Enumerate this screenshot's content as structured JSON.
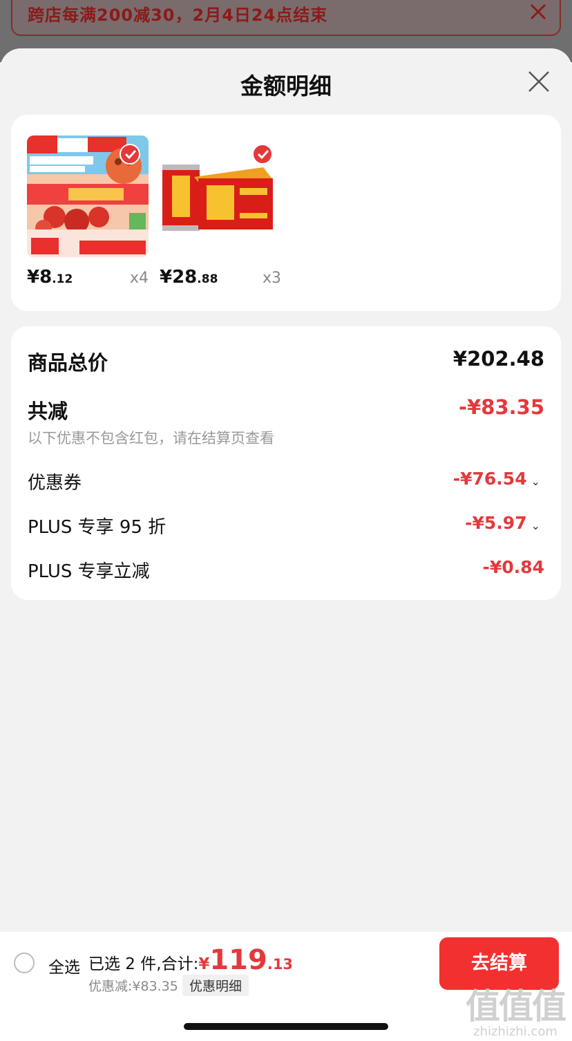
{
  "promo": {
    "text": "跨店每满200减30，2月4日24点结束"
  },
  "sheet": {
    "title": "金额明细"
  },
  "products": [
    {
      "price_int": "¥8",
      "price_dec": ".12",
      "qty": "x4",
      "thumb_icon": "hawthorn-snack-icon"
    },
    {
      "price_int": "¥28",
      "price_dec": ".88",
      "qty": "x3",
      "thumb_icon": "herbal-tea-can-icon"
    }
  ],
  "summary": {
    "total_label": "商品总价",
    "total_value": "¥202.48",
    "reduce_label": "共减",
    "reduce_value": "-¥83.35",
    "note": "以下优惠不包含红包，请在结算页查看",
    "items": [
      {
        "label": "优惠券",
        "value": "-¥76.54",
        "expandable": true
      },
      {
        "label": "PLUS 专享 95 折",
        "value": "-¥5.97",
        "expandable": true
      },
      {
        "label": "PLUS 专享立减",
        "value": "-¥0.84",
        "expandable": false
      }
    ]
  },
  "bottom": {
    "select_all": "全选",
    "selected_prefix": "已选 2 件,合计:",
    "currency": "¥",
    "amount_int": "119",
    "amount_dec": ".13",
    "discount": "优惠减:¥83.35",
    "detail_chip": "优惠明细",
    "checkout": "去结算"
  },
  "watermark": {
    "big": "值值值",
    "small": "zhizhizhi.com"
  },
  "colors": {
    "accent": "#e4393c",
    "checkout": "#f23030"
  }
}
